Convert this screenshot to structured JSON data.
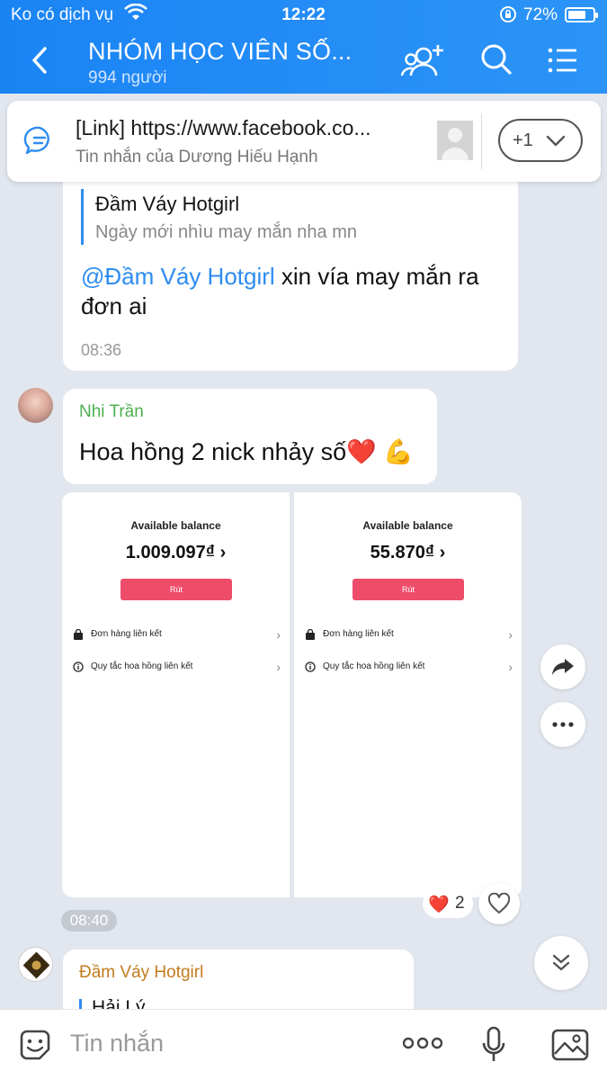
{
  "status_bar": {
    "carrier": "Ko có dịch vụ",
    "time": "12:22",
    "battery_percent": "72%",
    "battery_level": 0.72
  },
  "header": {
    "title": "NHÓM HỌC VIÊN SỐ...",
    "member_count": "994 người"
  },
  "pinned": {
    "title": "[Link] https://www.facebook.co...",
    "subtitle": "Tin nhắn của Dương Hiếu Hạnh",
    "more_label": "+1"
  },
  "messages": [
    {
      "quote_name": "Đầm Váy Hotgirl",
      "quote_text": "Ngày mới nhìu may mắn nha mn",
      "mention": "@Đầm Váy Hotgirl",
      "text": " xin vía may mắn ra đơn ai",
      "time": "08:36"
    },
    {
      "sender": "Nhi Trần",
      "text": "Hoa hồng 2 nick nhảy số❤️ 💪"
    },
    {
      "time": "08:40",
      "reaction_emoji": "❤️",
      "reaction_count": "2",
      "screenshots": [
        {
          "balance_label": "Available balance",
          "balance_value": "1.009.097₫",
          "button_label": "Rút",
          "row1": "Đơn hàng liên kết",
          "row2": "Quy tắc hoa hồng liên kết"
        },
        {
          "balance_label": "Available balance",
          "balance_value": "55.870₫",
          "button_label": "Rút",
          "row1": "Đơn hàng liên kết",
          "row2": "Quy tắc hoa hồng liên kết"
        }
      ]
    },
    {
      "sender": "Đầm Váy Hotgirl",
      "quote_name": "Hải Lý"
    }
  ],
  "input": {
    "placeholder": "Tin nhắn"
  },
  "colors": {
    "header_blue": "#1a84f5",
    "mention_blue": "#2d8cf0",
    "sender_green": "#4caf50",
    "sender_orange": "#c27c1e",
    "button_pink": "#ee4d6a"
  }
}
